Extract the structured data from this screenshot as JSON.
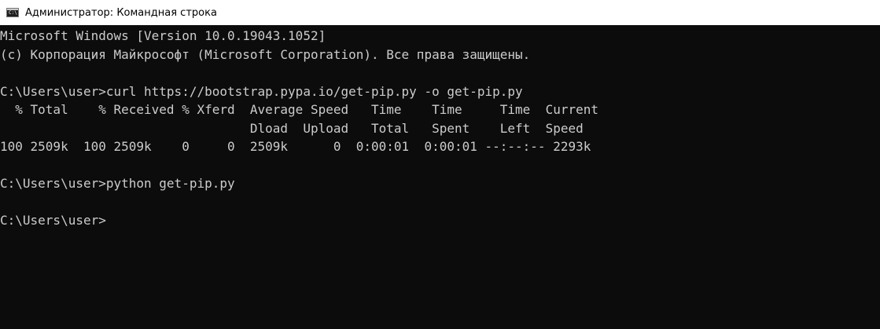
{
  "titlebar": {
    "icon": "command-prompt-icon",
    "icon_glyph": "C:\\",
    "title": "Администратор: Командная строка"
  },
  "console": {
    "lines": [
      "Microsoft Windows [Version 10.0.19043.1052]",
      "(c) Корпорация Майкрософт (Microsoft Corporation). Все права защищены.",
      "",
      "C:\\Users\\user>curl https://bootstrap.pypa.io/get-pip.py -o get-pip.py",
      "  % Total    % Received % Xferd  Average Speed   Time    Time     Time  Current",
      "                                 Dload  Upload   Total   Spent    Left  Speed",
      "100 2509k  100 2509k    0     0  2509k      0  0:00:01  0:00:01 --:--:-- 2293k",
      "",
      "C:\\Users\\user>python get-pip.py",
      "",
      "C:\\Users\\user>"
    ]
  },
  "colors": {
    "console_background": "#0c0c0c",
    "console_text": "#cccccc",
    "titlebar_background": "#ffffff"
  }
}
